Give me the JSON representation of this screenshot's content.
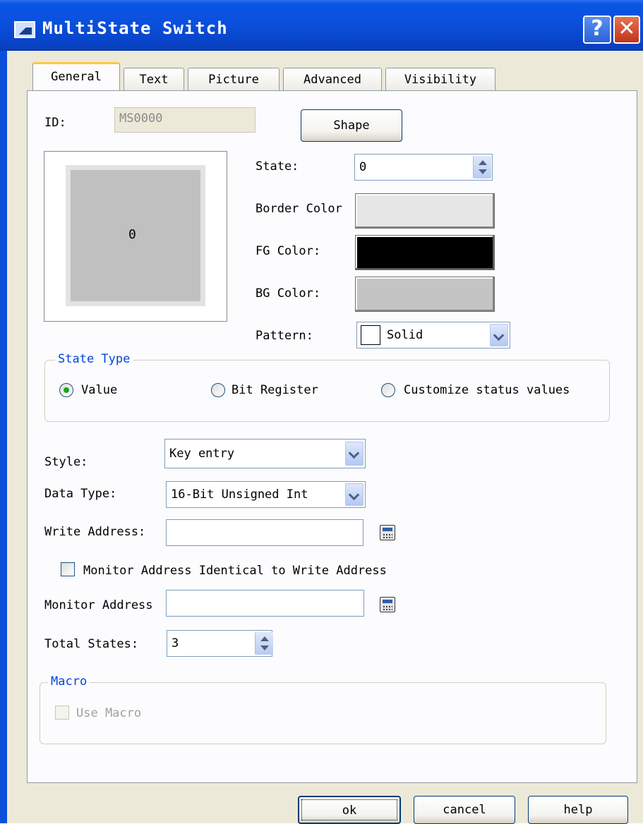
{
  "window": {
    "title": "MultiState Switch",
    "help_glyph": "?",
    "close_glyph": "✕"
  },
  "tabs": [
    {
      "label": "General"
    },
    {
      "label": "Text"
    },
    {
      "label": "Picture"
    },
    {
      "label": "Advanced"
    },
    {
      "label": "Visibility"
    }
  ],
  "general": {
    "id_label": "ID:",
    "id_value": "MS0000",
    "shape_button": "Shape",
    "preview_value": "0",
    "state_label": "State:",
    "state_value": "0",
    "border_color_label": "Border Color",
    "fg_color_label": "FG Color:",
    "bg_color_label": "BG Color:",
    "pattern_label": "Pattern:",
    "pattern_value": "Solid",
    "colors": {
      "border_color": "#e6e6e6",
      "fg_color": "#000000",
      "bg_color": "#c4c4c4"
    }
  },
  "state_type": {
    "title": "State Type",
    "options": [
      {
        "label": "Value",
        "checked": true
      },
      {
        "label": "Bit Register",
        "checked": false
      },
      {
        "label": "Customize status values",
        "checked": false
      }
    ]
  },
  "settings": {
    "style_label": "Style:",
    "style_value": "Key entry",
    "data_type_label": "Data Type:",
    "data_type_value": "16-Bit Unsigned Int",
    "write_address_label": "Write Address:",
    "write_address_value": "",
    "monitor_identical_label": "Monitor Address Identical to Write Address",
    "monitor_address_label": "Monitor Address",
    "monitor_address_value": "",
    "total_states_label": "Total States:",
    "total_states_value": "3"
  },
  "macro": {
    "title": "Macro",
    "use_macro_label": "Use Macro"
  },
  "footer": {
    "ok": "ok",
    "cancel": "cancel",
    "help": "help"
  }
}
